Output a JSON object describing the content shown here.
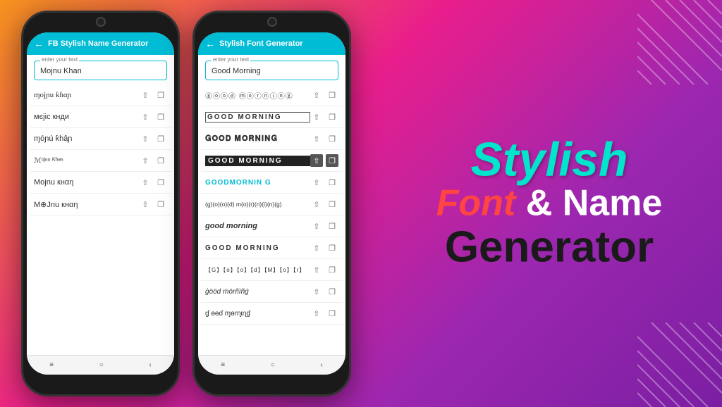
{
  "background": {
    "gradient": "linear-gradient(135deg, #f7931e 0%, #e91e8c 40%, #9c27b0 70%, #7b1fa2 100%)"
  },
  "phone1": {
    "header_title": "FB Stylish Name Generator",
    "input_label": "enter your text",
    "input_value": "Mojnu Khan",
    "fonts": [
      {
        "text": "ɱojɲu ƙɦαɲ",
        "id": "font1"
      },
      {
        "text": "мєϳiс кнди",
        "id": "font2"
      },
      {
        "text": "ɱóɲú ƙĥâɲ",
        "id": "font3"
      },
      {
        "text": "ℳᵒʲⁿᵘ ᴷʰᵃⁿ",
        "id": "font4"
      },
      {
        "text": "Mojnu кнαη",
        "id": "font5"
      },
      {
        "text": "M⊕Jnu кнαη",
        "id": "font6"
      }
    ]
  },
  "phone2": {
    "header_title": "Stylish Font Generator",
    "input_label": "enter your text",
    "input_value": "Good Morning",
    "fonts": [
      {
        "text": "ⓖⓞⓞⓓ ⓜⓞⓡⓝⓘⓝⓖ",
        "id": "font-circled",
        "style": "circled"
      },
      {
        "text": "GOOD MORNING",
        "id": "font-outlined",
        "style": "outlined"
      },
      {
        "text": "𝐆𝐎𝐎𝐃 𝐌𝐎𝐑𝐍𝐈𝐍𝐆",
        "id": "font-bold",
        "style": "bold-serif"
      },
      {
        "text": "GOOD MORNING",
        "id": "font-block",
        "style": "block"
      },
      {
        "text": "GOODMORNIN G",
        "id": "font-teal",
        "style": "teal"
      },
      {
        "text": "(g)(o)(o)(d) m(o)(r)(n)(i)(n)(g)",
        "id": "font-paren",
        "style": "paren"
      },
      {
        "text": "good morning",
        "id": "font-italic",
        "style": "italic"
      },
      {
        "text": "GOOD MORNING",
        "id": "font-caps",
        "style": "caps"
      },
      {
        "text": "【G】【o】【o】【d】 【M】【o】【r】【n】【i】【n】【g】",
        "id": "font-square",
        "style": "square"
      },
      {
        "text": "ġööd ṁörñïñġ",
        "id": "font-fancy",
        "style": "fancy"
      },
      {
        "text": "ɠ ɵɵɗ ɱɵɾɳɩɳɠ",
        "id": "font-fancy2",
        "style": "fancy2"
      }
    ]
  },
  "brand": {
    "line1": "Stylish",
    "line2_part1": "Font",
    "line2_part2": "& Name",
    "line3": "Generator"
  },
  "icons": {
    "back": "←",
    "share": "⇧",
    "copy": "❐",
    "menu": "≡",
    "home": "○",
    "back_nav": "‹"
  }
}
